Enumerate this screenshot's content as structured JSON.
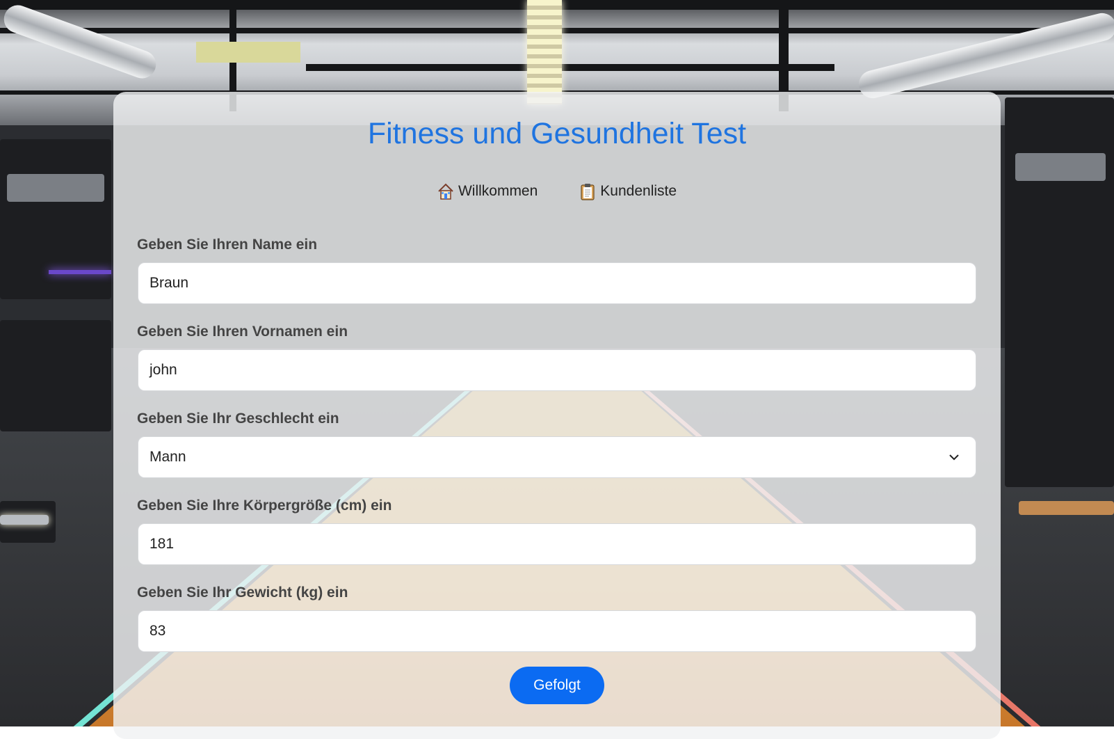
{
  "page": {
    "title": "Fitness und Gesundheit Test"
  },
  "nav": {
    "items": [
      {
        "label": "Willkommen",
        "icon": "house-icon"
      },
      {
        "label": "Kundenliste",
        "icon": "clipboard-icon"
      }
    ]
  },
  "form": {
    "name": {
      "label": "Geben Sie Ihren Name ein",
      "value": "Braun"
    },
    "vorname": {
      "label": "Geben Sie Ihren Vornamen ein",
      "value": "john"
    },
    "geschlecht": {
      "label": "Geben Sie Ihr Geschlecht ein",
      "value": "Mann"
    },
    "groesse": {
      "label": "Geben Sie Ihre Körpergröße (cm) ein",
      "value": "181"
    },
    "gewicht": {
      "label": "Geben Sie Ihr Gewicht (kg) ein",
      "value": "83"
    },
    "submit_label": "Gefolgt"
  },
  "colors": {
    "title": "#1f74e0",
    "button": "#0b6bf2"
  }
}
